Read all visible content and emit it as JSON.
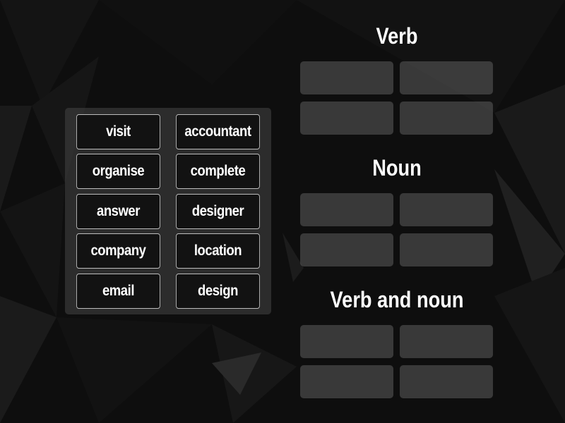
{
  "activity": {
    "type": "group sort",
    "word_bank": {
      "items": [
        {
          "label": "visit"
        },
        {
          "label": "accountant"
        },
        {
          "label": "organise"
        },
        {
          "label": "complete"
        },
        {
          "label": "answer"
        },
        {
          "label": "designer"
        },
        {
          "label": "company"
        },
        {
          "label": "location"
        },
        {
          "label": "email"
        },
        {
          "label": "design"
        }
      ]
    },
    "groups": [
      {
        "title": "Verb",
        "slots": 4
      },
      {
        "title": "Noun",
        "slots": 4
      },
      {
        "title": "Verb and noun",
        "slots": 4
      }
    ]
  },
  "colors": {
    "background": "#0e0e0e",
    "tile_background": "#121212",
    "tile_border": "#bdbdbd",
    "text": "#ffffff",
    "slot": "#3a3a3a"
  }
}
